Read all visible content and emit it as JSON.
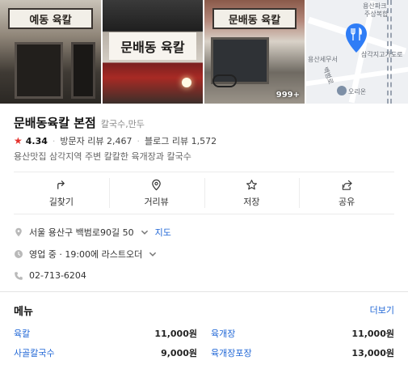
{
  "gallery": {
    "photo1_sign": "예동 육칼",
    "photo2_sign": "문배동 육칼",
    "photo3_sign": "문배동 육칼",
    "photo_count": "999+",
    "map_labels": [
      "용산파크",
      "주상복합",
      "삼각지고가도로",
      "용산세무서",
      "백범로",
      "오리온"
    ]
  },
  "place": {
    "name": "문배동육칼 본점",
    "category": "칼국수,만두",
    "rating": "4.34",
    "visitor_reviews": "방문자 리뷰 2,467",
    "blog_reviews": "블로그 리뷰 1,572",
    "description": "용산맛집 삼각지역 주변 칼칼한 육개장과 칼국수"
  },
  "actions": [
    {
      "label": "길찾기",
      "icon": "directions-icon"
    },
    {
      "label": "거리뷰",
      "icon": "streetview-icon"
    },
    {
      "label": "저장",
      "icon": "star-icon"
    },
    {
      "label": "공유",
      "icon": "share-icon"
    }
  ],
  "details": {
    "address": "서울 용산구 백범로90길 50",
    "map_link": "지도",
    "hours": "영업 중 · 19:00에 라스트오더",
    "phone": "02-713-6204"
  },
  "menu": {
    "title": "메뉴",
    "more": "더보기",
    "items": [
      {
        "name": "육칼",
        "price": "11,000원"
      },
      {
        "name": "육개장",
        "price": "11,000원"
      },
      {
        "name": "사골칼국수",
        "price": "9,000원"
      },
      {
        "name": "육개장포장",
        "price": "13,000원"
      }
    ]
  },
  "colors": {
    "accent_blue": "#1f66d6",
    "star_red": "#e5322d",
    "map_pin_blue": "#2f7df6"
  }
}
